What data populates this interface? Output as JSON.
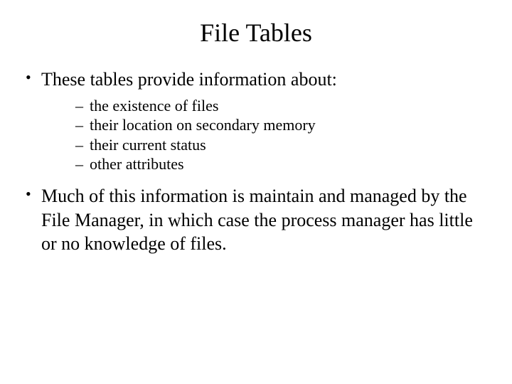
{
  "title": "File Tables",
  "bullets": [
    {
      "text": "These tables provide information about:",
      "subs": [
        "the existence of files",
        "their location on secondary memory",
        "their current status",
        "other attributes"
      ]
    },
    {
      "text": "Much of this information is maintain and managed by the File Manager, in which case the process manager has little or no knowledge of files.",
      "subs": []
    }
  ]
}
